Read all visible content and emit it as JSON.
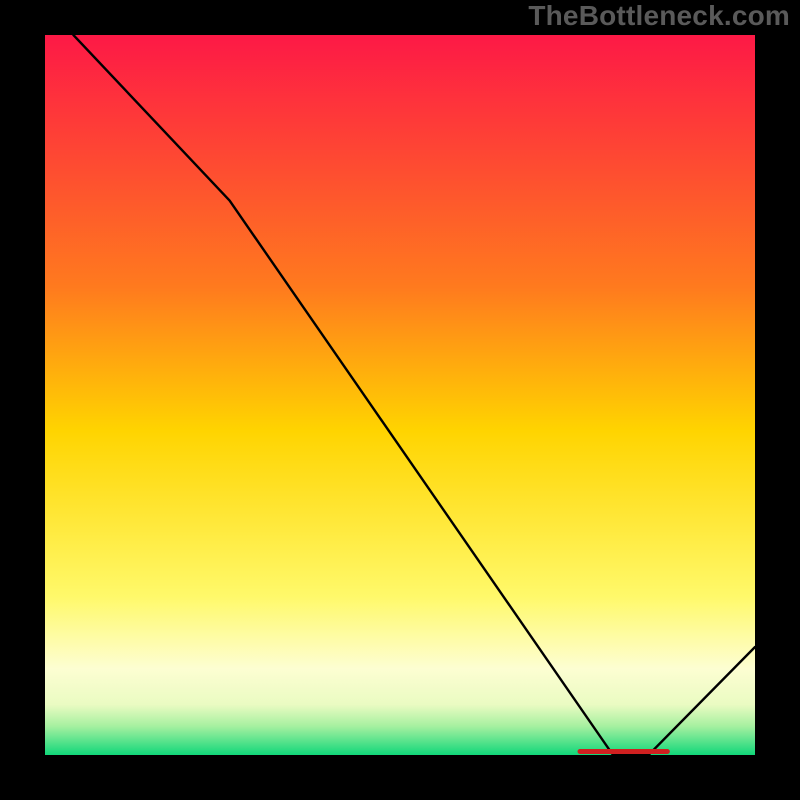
{
  "watermark": "TheBottleneck.com",
  "bottom_annotation": "",
  "chart_data": {
    "type": "line",
    "title": "",
    "xlabel": "",
    "ylabel": "",
    "xlim": [
      0,
      100
    ],
    "ylim": [
      0,
      100
    ],
    "grid": false,
    "legend": false,
    "x": [
      4,
      26,
      80,
      85,
      100
    ],
    "y": [
      100,
      77,
      0,
      0,
      15
    ],
    "gradient_stops": [
      {
        "offset": 0,
        "color": "#fd1946"
      },
      {
        "offset": 0.35,
        "color": "#ff7a1e"
      },
      {
        "offset": 0.55,
        "color": "#ffd400"
      },
      {
        "offset": 0.78,
        "color": "#fff96a"
      },
      {
        "offset": 0.88,
        "color": "#fdfed2"
      },
      {
        "offset": 0.93,
        "color": "#eafbc2"
      },
      {
        "offset": 0.96,
        "color": "#a6f0a0"
      },
      {
        "offset": 1.0,
        "color": "#11d77a"
      }
    ],
    "line_color": "#000000",
    "line_width": 2.4,
    "bottom_marker": {
      "x_start": 75,
      "x_end": 88,
      "color": "#d02020",
      "thickness": 5
    }
  }
}
